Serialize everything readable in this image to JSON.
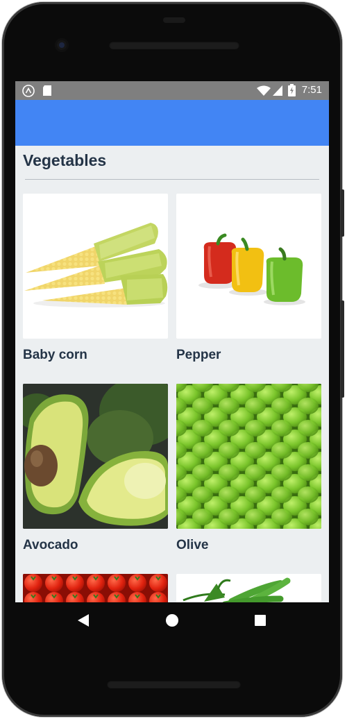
{
  "status_bar": {
    "time": "7:51"
  },
  "page": {
    "title": "Vegetables"
  },
  "items": [
    {
      "label": "Baby corn"
    },
    {
      "label": "Pepper"
    },
    {
      "label": "Avocado"
    },
    {
      "label": "Olive"
    },
    {
      "label": ""
    },
    {
      "label": ""
    }
  ],
  "colors": {
    "app_bar": "#4285f4",
    "status_bar": "#7f7f7f",
    "screen_bg": "#eceff1",
    "text": "#243447"
  },
  "icons": [
    "launcher-a-icon",
    "sd-card-icon",
    "wifi-icon",
    "signal-icon",
    "battery-charging-icon",
    "back-icon",
    "home-icon",
    "recents-icon"
  ]
}
